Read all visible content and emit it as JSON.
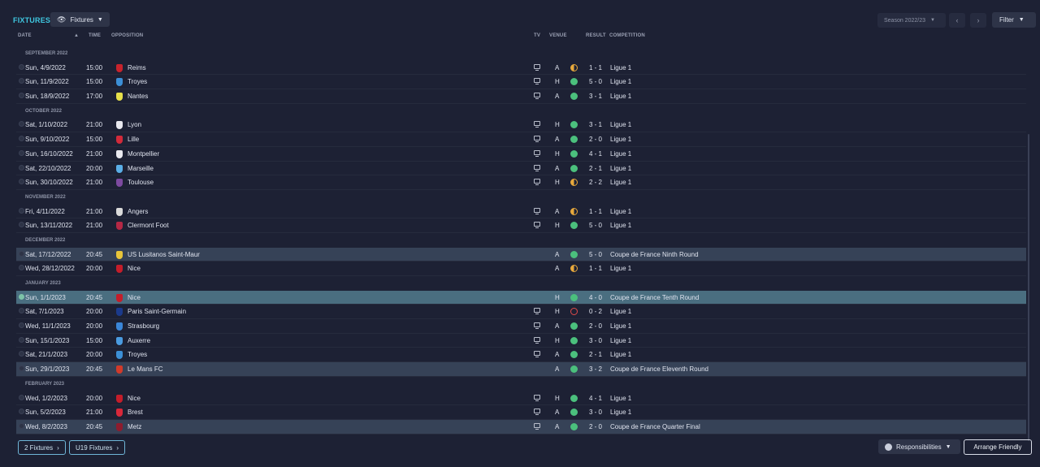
{
  "header": {
    "title": "FIXTURES",
    "view_label": "Fixtures",
    "season_label": "Season 2022/23",
    "filter_label": "Filter"
  },
  "columns": {
    "date": "DATE",
    "time": "TIME",
    "opposition": "OPPOSITION",
    "tv": "TV",
    "venue": "VENUE",
    "result": "RESULT",
    "competition": "COMPETITION"
  },
  "groups": [
    {
      "month": "SEPTEMBER 2022",
      "rows": [
        {
          "date": "Sun, 4/9/2022",
          "time": "15:00",
          "opp": "Reims",
          "crest": "#c8232c",
          "tv": true,
          "venue": "A",
          "outcome": "d",
          "result": "1 - 1",
          "comp": "Ligue 1",
          "style": ""
        },
        {
          "date": "Sun, 11/9/2022",
          "time": "15:00",
          "opp": "Troyes",
          "crest": "#3c8fd6",
          "tv": true,
          "venue": "H",
          "outcome": "w",
          "result": "5 - 0",
          "comp": "Ligue 1",
          "style": ""
        },
        {
          "date": "Sun, 18/9/2022",
          "time": "17:00",
          "opp": "Nantes",
          "crest": "#e6e04a",
          "tv": true,
          "venue": "A",
          "outcome": "w",
          "result": "3 - 1",
          "comp": "Ligue 1",
          "style": ""
        }
      ]
    },
    {
      "month": "OCTOBER 2022",
      "rows": [
        {
          "date": "Sat, 1/10/2022",
          "time": "21:00",
          "opp": "Lyon",
          "crest": "#e8e8ee",
          "tv": true,
          "venue": "H",
          "outcome": "w",
          "result": "3 - 1",
          "comp": "Ligue 1",
          "style": ""
        },
        {
          "date": "Sun, 9/10/2022",
          "time": "15:00",
          "opp": "Lille",
          "crest": "#d22a3a",
          "tv": true,
          "venue": "A",
          "outcome": "w",
          "result": "2 - 0",
          "comp": "Ligue 1",
          "style": ""
        },
        {
          "date": "Sun, 16/10/2022",
          "time": "21:00",
          "opp": "Montpellier",
          "crest": "#e9e9ef",
          "tv": true,
          "venue": "H",
          "outcome": "w",
          "result": "4 - 1",
          "comp": "Ligue 1",
          "style": ""
        },
        {
          "date": "Sat, 22/10/2022",
          "time": "20:00",
          "opp": "Marseille",
          "crest": "#5aaee6",
          "tv": true,
          "venue": "A",
          "outcome": "w",
          "result": "2 - 1",
          "comp": "Ligue 1",
          "style": ""
        },
        {
          "date": "Sun, 30/10/2022",
          "time": "21:00",
          "opp": "Toulouse",
          "crest": "#7d4aa0",
          "tv": true,
          "venue": "H",
          "outcome": "d",
          "result": "2 - 2",
          "comp": "Ligue 1",
          "style": ""
        }
      ]
    },
    {
      "month": "NOVEMBER 2022",
      "rows": [
        {
          "date": "Fri, 4/11/2022",
          "time": "21:00",
          "opp": "Angers",
          "crest": "#dadada",
          "tv": true,
          "venue": "A",
          "outcome": "d",
          "result": "1 - 1",
          "comp": "Ligue 1",
          "style": ""
        },
        {
          "date": "Sun, 13/11/2022",
          "time": "21:00",
          "opp": "Clermont Foot",
          "crest": "#b52845",
          "tv": true,
          "venue": "H",
          "outcome": "w",
          "result": "5 - 0",
          "comp": "Ligue 1",
          "style": ""
        }
      ]
    },
    {
      "month": "DECEMBER 2022",
      "rows": [
        {
          "date": "Sat, 17/12/2022",
          "time": "20:45",
          "opp": "US Lusitanos Saint-Maur",
          "crest": "#e8c53a",
          "tv": false,
          "venue": "A",
          "outcome": "w",
          "result": "5 - 0",
          "comp": "Coupe de France Ninth Round",
          "style": "hl"
        },
        {
          "date": "Wed, 28/12/2022",
          "time": "20:00",
          "opp": "Nice",
          "crest": "#c41d2a",
          "tv": false,
          "venue": "A",
          "outcome": "d",
          "result": "1 - 1",
          "comp": "Ligue 1",
          "style": ""
        }
      ]
    },
    {
      "month": "JANUARY 2023",
      "rows": [
        {
          "date": "Sun, 1/1/2023",
          "time": "20:45",
          "opp": "Nice",
          "crest": "#c41d2a",
          "tv": false,
          "venue": "H",
          "outcome": "w",
          "result": "4 - 0",
          "comp": "Coupe de France Tenth Round",
          "style": "sel"
        },
        {
          "date": "Sat, 7/1/2023",
          "time": "20:00",
          "opp": "Paris Saint-Germain",
          "crest": "#1b3a8c",
          "tv": true,
          "venue": "H",
          "outcome": "l",
          "result": "0 - 2",
          "comp": "Ligue 1",
          "style": ""
        },
        {
          "date": "Wed, 11/1/2023",
          "time": "20:00",
          "opp": "Strasbourg",
          "crest": "#3a86d8",
          "tv": true,
          "venue": "A",
          "outcome": "w",
          "result": "2 - 0",
          "comp": "Ligue 1",
          "style": ""
        },
        {
          "date": "Sun, 15/1/2023",
          "time": "15:00",
          "opp": "Auxerre",
          "crest": "#4a9be0",
          "tv": true,
          "venue": "H",
          "outcome": "w",
          "result": "3 - 0",
          "comp": "Ligue 1",
          "style": ""
        },
        {
          "date": "Sat, 21/1/2023",
          "time": "20:00",
          "opp": "Troyes",
          "crest": "#3c8fd6",
          "tv": true,
          "venue": "A",
          "outcome": "w",
          "result": "2 - 1",
          "comp": "Ligue 1",
          "style": ""
        },
        {
          "date": "Sun, 29/1/2023",
          "time": "20:45",
          "opp": "Le Mans FC",
          "crest": "#d23a2a",
          "tv": false,
          "venue": "A",
          "outcome": "w",
          "result": "3 - 2",
          "comp": "Coupe de France Eleventh Round",
          "style": "hl"
        }
      ]
    },
    {
      "month": "FEBRUARY 2023",
      "rows": [
        {
          "date": "Wed, 1/2/2023",
          "time": "20:00",
          "opp": "Nice",
          "crest": "#c41d2a",
          "tv": true,
          "venue": "H",
          "outcome": "w",
          "result": "4 - 1",
          "comp": "Ligue 1",
          "style": ""
        },
        {
          "date": "Sun, 5/2/2023",
          "time": "21:00",
          "opp": "Brest",
          "crest": "#d8283a",
          "tv": true,
          "venue": "A",
          "outcome": "w",
          "result": "3 - 0",
          "comp": "Ligue 1",
          "style": ""
        },
        {
          "date": "Wed, 8/2/2023",
          "time": "20:45",
          "opp": "Metz",
          "crest": "#8e1c2e",
          "tv": true,
          "venue": "A",
          "outcome": "w",
          "result": "2 - 0",
          "comp": "Coupe de France Quarter Final",
          "style": "hl"
        }
      ]
    }
  ],
  "footer": {
    "fixtures_link": "2 Fixtures",
    "u19_link": "U19 Fixtures",
    "responsibilities_label": "Responsibilities",
    "arrange_label": "Arrange Friendly"
  }
}
